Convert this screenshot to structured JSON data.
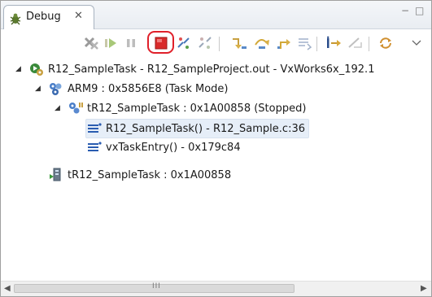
{
  "view": {
    "tab_label": "Debug",
    "close_glyph": "✕",
    "minimize_glyph": "−",
    "maximize_glyph": "□"
  },
  "toolbar": {
    "buttons": [
      {
        "name": "remove-all-terminated-icon"
      },
      {
        "name": "resume-icon"
      },
      {
        "name": "suspend-icon"
      },
      {
        "name": "terminate-icon",
        "highlighted": true
      },
      {
        "name": "connect-icon"
      },
      {
        "name": "disconnect-icon"
      },
      {
        "name": "step-into-icon"
      },
      {
        "name": "step-over-icon"
      },
      {
        "name": "step-return-icon"
      },
      {
        "name": "drop-to-frame-icon"
      },
      {
        "name": "instruction-stepping-icon"
      },
      {
        "name": "use-step-filters-icon"
      },
      {
        "name": "sync-icon"
      },
      {
        "name": "view-menu-icon"
      }
    ]
  },
  "tree": {
    "items": [
      {
        "label": "R12_SampleTask - R12_SampleProject.out - VxWorks6x_192.1",
        "icon": "launch-icon",
        "expanded": true
      },
      {
        "label": "ARM9 : 0x5856E8 (Task Mode)",
        "icon": "target-process-icon",
        "expanded": true
      },
      {
        "label": "tR12_SampleTask : 0x1A00858 (Stopped)",
        "icon": "thread-suspended-icon",
        "expanded": true
      },
      {
        "label": "R12_SampleTask() - R12_Sample.c:36",
        "icon": "stack-frame-icon",
        "selected": true
      },
      {
        "label": "vxTaskEntry() - 0x179c84",
        "icon": "stack-frame-icon"
      },
      {
        "label": "tR12_SampleTask : 0x1A00858",
        "icon": "task-icon"
      }
    ]
  },
  "scrollbar": {
    "left_arrow": "◀",
    "right_arrow": "▶",
    "grip": "III"
  },
  "colors": {
    "highlight": "#e0202a",
    "selection": "#e6eef8"
  }
}
